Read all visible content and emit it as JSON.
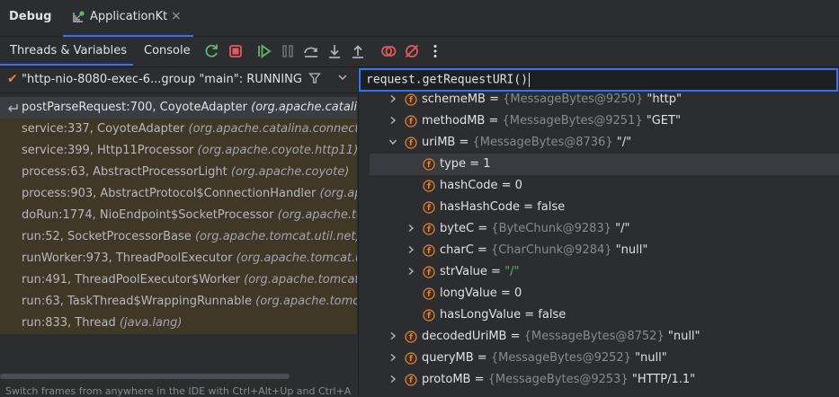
{
  "top": {
    "title": "Debug",
    "tab_label": "ApplicationKt",
    "close_glyph": "×"
  },
  "toolbar": {
    "tabs": [
      "Threads & Variables",
      "Console"
    ],
    "buttons": [
      "rerun-icon",
      "stop-icon",
      "resume-icon",
      "pause-icon",
      "step-over-icon",
      "step-into-icon",
      "step-out-icon",
      "view-breakpoints-icon",
      "mute-breakpoints-icon",
      "more-icon"
    ]
  },
  "thread": {
    "text": "\"http-nio-8080-exec-6...group \"main\": RUNNING"
  },
  "frames": [
    {
      "name": "postParseRequest:700, CoyoteAdapter",
      "pkg": "(org.apache.catalina"
    },
    {
      "name": "service:337, CoyoteAdapter",
      "pkg": "(org.apache.catalina.connector"
    },
    {
      "name": "service:399, Http11Processor",
      "pkg": "(org.apache.coyote.http11)"
    },
    {
      "name": "process:63, AbstractProcessorLight",
      "pkg": "(org.apache.coyote)"
    },
    {
      "name": "process:903, AbstractProtocol$ConnectionHandler",
      "pkg": "(org.apa"
    },
    {
      "name": "doRun:1774, NioEndpoint$SocketProcessor",
      "pkg": "(org.apache.tom"
    },
    {
      "name": "run:52, SocketProcessorBase",
      "pkg": "(org.apache.tomcat.util.net)"
    },
    {
      "name": "runWorker:973, ThreadPoolExecutor",
      "pkg": "(org.apache.tomcat.util"
    },
    {
      "name": "run:491, ThreadPoolExecutor$Worker",
      "pkg": "(org.apache.tomcat.u"
    },
    {
      "name": "run:63, TaskThread$WrappingRunnable",
      "pkg": "(org.apache.tomcat"
    },
    {
      "name": "run:833, Thread",
      "pkg": "(java.lang)"
    }
  ],
  "hint": "Switch frames from anywhere in the IDE with Ctrl+Alt+Up and Ctrl+Al...",
  "evaluate": {
    "expression": "request.getRequestURI()"
  },
  "variables": [
    {
      "name": "schemeMB",
      "type": "{MessageBytes@9250}",
      "value": "\"http\"",
      "depth": 0,
      "expand": "collapsed"
    },
    {
      "name": "methodMB",
      "type": "{MessageBytes@9251}",
      "value": "\"GET\"",
      "depth": 0,
      "expand": "collapsed"
    },
    {
      "name": "uriMB",
      "type": "{MessageBytes@8736}",
      "value": "\"/\"",
      "depth": 0,
      "expand": "expanded"
    },
    {
      "name": "type",
      "type": "",
      "value": "1",
      "depth": 1,
      "expand": "none"
    },
    {
      "name": "hashCode",
      "type": "",
      "value": "0",
      "depth": 1,
      "expand": "none"
    },
    {
      "name": "hasHashCode",
      "type": "",
      "value": "false",
      "depth": 1,
      "expand": "none"
    },
    {
      "name": "byteC",
      "type": "{ByteChunk@9283}",
      "value": "\"/\"",
      "depth": 1,
      "expand": "collapsed"
    },
    {
      "name": "charC",
      "type": "{CharChunk@9284}",
      "value": "\"null\"",
      "depth": 1,
      "expand": "collapsed"
    },
    {
      "name": "strValue",
      "type": "",
      "value": "\"/\"",
      "depth": 1,
      "expand": "collapsed",
      "string": true
    },
    {
      "name": "longValue",
      "type": "",
      "value": "0",
      "depth": 1,
      "expand": "none"
    },
    {
      "name": "hasLongValue",
      "type": "",
      "value": "false",
      "depth": 1,
      "expand": "none"
    },
    {
      "name": "decodedUriMB",
      "type": "{MessageBytes@8752}",
      "value": "\"null\"",
      "depth": 0,
      "expand": "collapsed"
    },
    {
      "name": "queryMB",
      "type": "{MessageBytes@9252}",
      "value": "\"null\"",
      "depth": 0,
      "expand": "collapsed"
    },
    {
      "name": "protoMB",
      "type": "{MessageBytes@9253}",
      "value": "\"HTTP/1.1\"",
      "depth": 0,
      "expand": "collapsed"
    }
  ],
  "colors": {
    "accent": "#3574f0",
    "field_icon": "#e5853c",
    "frame_bg": "#3f3826",
    "string": "#6aab73"
  }
}
